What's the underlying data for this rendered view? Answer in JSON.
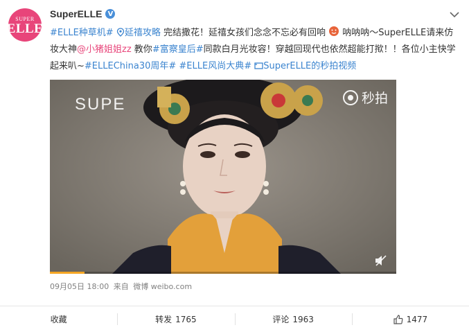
{
  "post": {
    "author": {
      "avatar_line1": "SUPER",
      "avatar_line2": "ELLE",
      "name": "SuperELLE",
      "verified_glyph": "V",
      "avatar_color": "#e8457a"
    },
    "content": {
      "tag1": "#ELLE种草机#",
      "link_title": "延禧攻略",
      "text1": " 完结撒花！延禧女孩们念念不忘必有回响",
      "text2": " 呐呐呐～SuperELLE请来仿妆大神",
      "mention": "@小猪姐姐zz",
      "text3": " 教你",
      "tag2": "#富察皇后#",
      "text4": "同款白月光妆容！穿越回现代也依然超能打揿！！各位小主快学起来叭~",
      "tag3": "#ELLEChina30周年#",
      "tag4": " #ELLE风尚大典#",
      "video_link": "SuperELLE的秒拍视频"
    },
    "video": {
      "watermark": "SUPE",
      "platform_label": "秒拍",
      "progress_fraction": 0.1
    },
    "meta": {
      "date": "09月05日 18:00",
      "from_label": "来自",
      "source": "微博 weibo.com"
    },
    "actions": {
      "favorite_label": "收藏",
      "repost_label": "转发",
      "repost_count": "1765",
      "comment_label": "评论",
      "comment_count": "1963",
      "like_count": "1477"
    },
    "colors": {
      "link": "#3b84cf",
      "mention": "#e8457a",
      "verified": "#4a90d9",
      "progress": "#f5a623"
    }
  }
}
